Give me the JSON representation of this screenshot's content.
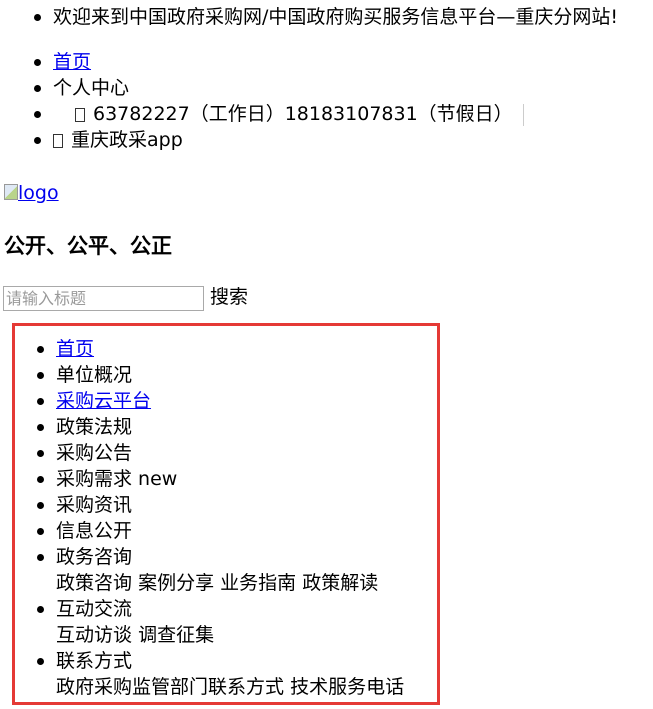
{
  "header": {
    "welcome": "欢迎来到中国政府采购网/中国政府购买服务信息平台—重庆分网站!",
    "home_link": "首页",
    "personal_center": "个人中心",
    "phone": "63782227（工作日）18183107831（节假日）",
    "app_label": "重庆政采app"
  },
  "branding": {
    "logo_alt": "logo",
    "slogan": "公开、公平、公正"
  },
  "search": {
    "placeholder": "请输入标题",
    "button_label": "搜索"
  },
  "nav": {
    "items": [
      {
        "label": "首页"
      },
      {
        "label": "单位概况"
      },
      {
        "label": "采购云平台"
      },
      {
        "label": "政策法规"
      },
      {
        "label": "采购公告"
      },
      {
        "label": "采购需求 new"
      },
      {
        "label": "采购资讯"
      },
      {
        "label": "信息公开"
      },
      {
        "label": "政务咨询",
        "sub": [
          "政策咨询",
          "案例分享",
          "业务指南",
          "政策解读"
        ]
      },
      {
        "label": "互动交流",
        "sub": [
          "互动访谈",
          "调查征集"
        ]
      },
      {
        "label": "联系方式",
        "sub": [
          "政府采购监管部门联系方式",
          "技术服务电话"
        ]
      }
    ]
  },
  "colors": {
    "link": "#0000ee",
    "highlight_border": "#e53935"
  }
}
